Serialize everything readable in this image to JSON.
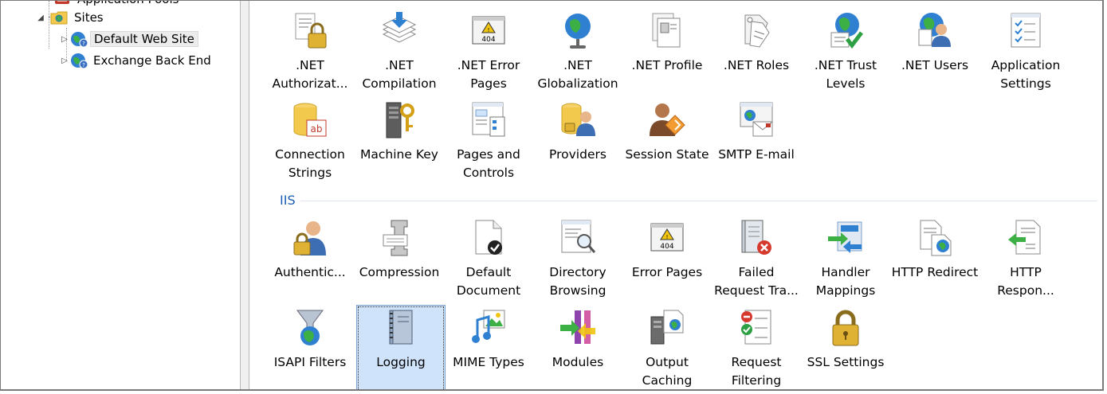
{
  "tree": {
    "items": [
      {
        "label": "Application Pools"
      },
      {
        "label": "Sites"
      },
      {
        "label": "Default Web Site"
      },
      {
        "label": "Exchange Back End"
      }
    ]
  },
  "groups": {
    "iis": {
      "label": "IIS"
    }
  },
  "features": {
    "net_authorization": {
      "label": ".NET Authorizat...",
      "icon": "net-authorization-icon"
    },
    "net_compilation": {
      "label": ".NET Compilation",
      "icon": "net-compilation-icon"
    },
    "net_error_pages": {
      "label": ".NET Error Pages",
      "icon": "net-error-pages-icon",
      "badge": "404"
    },
    "net_globalization": {
      "label": ".NET Globalization",
      "icon": "net-globalization-icon"
    },
    "net_profile": {
      "label": ".NET Profile",
      "icon": "net-profile-icon"
    },
    "net_roles": {
      "label": ".NET Roles",
      "icon": "net-roles-icon"
    },
    "net_trust_levels": {
      "label": ".NET Trust Levels",
      "icon": "net-trust-levels-icon"
    },
    "net_users": {
      "label": ".NET Users",
      "icon": "net-users-icon"
    },
    "application_settings": {
      "label": "Application Settings",
      "icon": "application-settings-icon"
    },
    "connection_strings": {
      "label": "Connection Strings",
      "icon": "connection-strings-icon",
      "badge": "ab"
    },
    "machine_key": {
      "label": "Machine Key",
      "icon": "machine-key-icon"
    },
    "pages_and_controls": {
      "label": "Pages and Controls",
      "icon": "pages-and-controls-icon"
    },
    "providers": {
      "label": "Providers",
      "icon": "providers-icon"
    },
    "session_state": {
      "label": "Session State",
      "icon": "session-state-icon"
    },
    "smtp_email": {
      "label": "SMTP E-mail",
      "icon": "smtp-email-icon"
    },
    "authentication": {
      "label": "Authentic...",
      "icon": "authentication-icon"
    },
    "compression": {
      "label": "Compression",
      "icon": "compression-icon"
    },
    "default_document": {
      "label": "Default Document",
      "icon": "default-document-icon"
    },
    "directory_browsing": {
      "label": "Directory Browsing",
      "icon": "directory-browsing-icon"
    },
    "error_pages": {
      "label": "Error Pages",
      "icon": "error-pages-icon",
      "badge": "404"
    },
    "failed_request_tracing": {
      "label": "Failed Request Tra...",
      "icon": "failed-request-tracing-icon"
    },
    "handler_mappings": {
      "label": "Handler Mappings",
      "icon": "handler-mappings-icon"
    },
    "http_redirect": {
      "label": "HTTP Redirect",
      "icon": "http-redirect-icon"
    },
    "http_response": {
      "label": "HTTP Respon...",
      "icon": "http-response-headers-icon"
    },
    "isapi_filters": {
      "label": "ISAPI Filters",
      "icon": "isapi-filters-icon"
    },
    "logging": {
      "label": "Logging",
      "icon": "logging-icon",
      "selected": true
    },
    "mime_types": {
      "label": "MIME Types",
      "icon": "mime-types-icon"
    },
    "modules": {
      "label": "Modules",
      "icon": "modules-icon"
    },
    "output_caching": {
      "label": "Output Caching",
      "icon": "output-caching-icon"
    },
    "request_filtering": {
      "label": "Request Filtering",
      "icon": "request-filtering-icon"
    },
    "ssl_settings": {
      "label": "SSL Settings",
      "icon": "ssl-settings-icon"
    }
  },
  "colors": {
    "group_header": "#1a5fb4",
    "selection_fill": "#cfe3fb",
    "selection_border": "#7da2ce"
  }
}
